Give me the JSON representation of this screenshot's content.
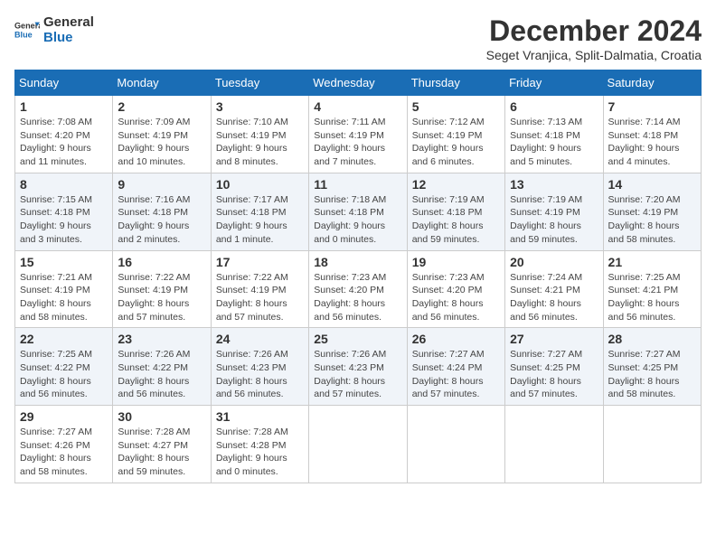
{
  "logo": {
    "text_general": "General",
    "text_blue": "Blue"
  },
  "header": {
    "month": "December 2024",
    "location": "Seget Vranjica, Split-Dalmatia, Croatia"
  },
  "weekdays": [
    "Sunday",
    "Monday",
    "Tuesday",
    "Wednesday",
    "Thursday",
    "Friday",
    "Saturday"
  ],
  "weeks": [
    [
      {
        "day": "1",
        "sunrise": "Sunrise: 7:08 AM",
        "sunset": "Sunset: 4:20 PM",
        "daylight": "Daylight: 9 hours and 11 minutes."
      },
      {
        "day": "2",
        "sunrise": "Sunrise: 7:09 AM",
        "sunset": "Sunset: 4:19 PM",
        "daylight": "Daylight: 9 hours and 10 minutes."
      },
      {
        "day": "3",
        "sunrise": "Sunrise: 7:10 AM",
        "sunset": "Sunset: 4:19 PM",
        "daylight": "Daylight: 9 hours and 8 minutes."
      },
      {
        "day": "4",
        "sunrise": "Sunrise: 7:11 AM",
        "sunset": "Sunset: 4:19 PM",
        "daylight": "Daylight: 9 hours and 7 minutes."
      },
      {
        "day": "5",
        "sunrise": "Sunrise: 7:12 AM",
        "sunset": "Sunset: 4:19 PM",
        "daylight": "Daylight: 9 hours and 6 minutes."
      },
      {
        "day": "6",
        "sunrise": "Sunrise: 7:13 AM",
        "sunset": "Sunset: 4:18 PM",
        "daylight": "Daylight: 9 hours and 5 minutes."
      },
      {
        "day": "7",
        "sunrise": "Sunrise: 7:14 AM",
        "sunset": "Sunset: 4:18 PM",
        "daylight": "Daylight: 9 hours and 4 minutes."
      }
    ],
    [
      {
        "day": "8",
        "sunrise": "Sunrise: 7:15 AM",
        "sunset": "Sunset: 4:18 PM",
        "daylight": "Daylight: 9 hours and 3 minutes."
      },
      {
        "day": "9",
        "sunrise": "Sunrise: 7:16 AM",
        "sunset": "Sunset: 4:18 PM",
        "daylight": "Daylight: 9 hours and 2 minutes."
      },
      {
        "day": "10",
        "sunrise": "Sunrise: 7:17 AM",
        "sunset": "Sunset: 4:18 PM",
        "daylight": "Daylight: 9 hours and 1 minute."
      },
      {
        "day": "11",
        "sunrise": "Sunrise: 7:18 AM",
        "sunset": "Sunset: 4:18 PM",
        "daylight": "Daylight: 9 hours and 0 minutes."
      },
      {
        "day": "12",
        "sunrise": "Sunrise: 7:19 AM",
        "sunset": "Sunset: 4:18 PM",
        "daylight": "Daylight: 8 hours and 59 minutes."
      },
      {
        "day": "13",
        "sunrise": "Sunrise: 7:19 AM",
        "sunset": "Sunset: 4:19 PM",
        "daylight": "Daylight: 8 hours and 59 minutes."
      },
      {
        "day": "14",
        "sunrise": "Sunrise: 7:20 AM",
        "sunset": "Sunset: 4:19 PM",
        "daylight": "Daylight: 8 hours and 58 minutes."
      }
    ],
    [
      {
        "day": "15",
        "sunrise": "Sunrise: 7:21 AM",
        "sunset": "Sunset: 4:19 PM",
        "daylight": "Daylight: 8 hours and 58 minutes."
      },
      {
        "day": "16",
        "sunrise": "Sunrise: 7:22 AM",
        "sunset": "Sunset: 4:19 PM",
        "daylight": "Daylight: 8 hours and 57 minutes."
      },
      {
        "day": "17",
        "sunrise": "Sunrise: 7:22 AM",
        "sunset": "Sunset: 4:19 PM",
        "daylight": "Daylight: 8 hours and 57 minutes."
      },
      {
        "day": "18",
        "sunrise": "Sunrise: 7:23 AM",
        "sunset": "Sunset: 4:20 PM",
        "daylight": "Daylight: 8 hours and 56 minutes."
      },
      {
        "day": "19",
        "sunrise": "Sunrise: 7:23 AM",
        "sunset": "Sunset: 4:20 PM",
        "daylight": "Daylight: 8 hours and 56 minutes."
      },
      {
        "day": "20",
        "sunrise": "Sunrise: 7:24 AM",
        "sunset": "Sunset: 4:21 PM",
        "daylight": "Daylight: 8 hours and 56 minutes."
      },
      {
        "day": "21",
        "sunrise": "Sunrise: 7:25 AM",
        "sunset": "Sunset: 4:21 PM",
        "daylight": "Daylight: 8 hours and 56 minutes."
      }
    ],
    [
      {
        "day": "22",
        "sunrise": "Sunrise: 7:25 AM",
        "sunset": "Sunset: 4:22 PM",
        "daylight": "Daylight: 8 hours and 56 minutes."
      },
      {
        "day": "23",
        "sunrise": "Sunrise: 7:26 AM",
        "sunset": "Sunset: 4:22 PM",
        "daylight": "Daylight: 8 hours and 56 minutes."
      },
      {
        "day": "24",
        "sunrise": "Sunrise: 7:26 AM",
        "sunset": "Sunset: 4:23 PM",
        "daylight": "Daylight: 8 hours and 56 minutes."
      },
      {
        "day": "25",
        "sunrise": "Sunrise: 7:26 AM",
        "sunset": "Sunset: 4:23 PM",
        "daylight": "Daylight: 8 hours and 57 minutes."
      },
      {
        "day": "26",
        "sunrise": "Sunrise: 7:27 AM",
        "sunset": "Sunset: 4:24 PM",
        "daylight": "Daylight: 8 hours and 57 minutes."
      },
      {
        "day": "27",
        "sunrise": "Sunrise: 7:27 AM",
        "sunset": "Sunset: 4:25 PM",
        "daylight": "Daylight: 8 hours and 57 minutes."
      },
      {
        "day": "28",
        "sunrise": "Sunrise: 7:27 AM",
        "sunset": "Sunset: 4:25 PM",
        "daylight": "Daylight: 8 hours and 58 minutes."
      }
    ],
    [
      {
        "day": "29",
        "sunrise": "Sunrise: 7:27 AM",
        "sunset": "Sunset: 4:26 PM",
        "daylight": "Daylight: 8 hours and 58 minutes."
      },
      {
        "day": "30",
        "sunrise": "Sunrise: 7:28 AM",
        "sunset": "Sunset: 4:27 PM",
        "daylight": "Daylight: 8 hours and 59 minutes."
      },
      {
        "day": "31",
        "sunrise": "Sunrise: 7:28 AM",
        "sunset": "Sunset: 4:28 PM",
        "daylight": "Daylight: 9 hours and 0 minutes."
      },
      null,
      null,
      null,
      null
    ]
  ]
}
